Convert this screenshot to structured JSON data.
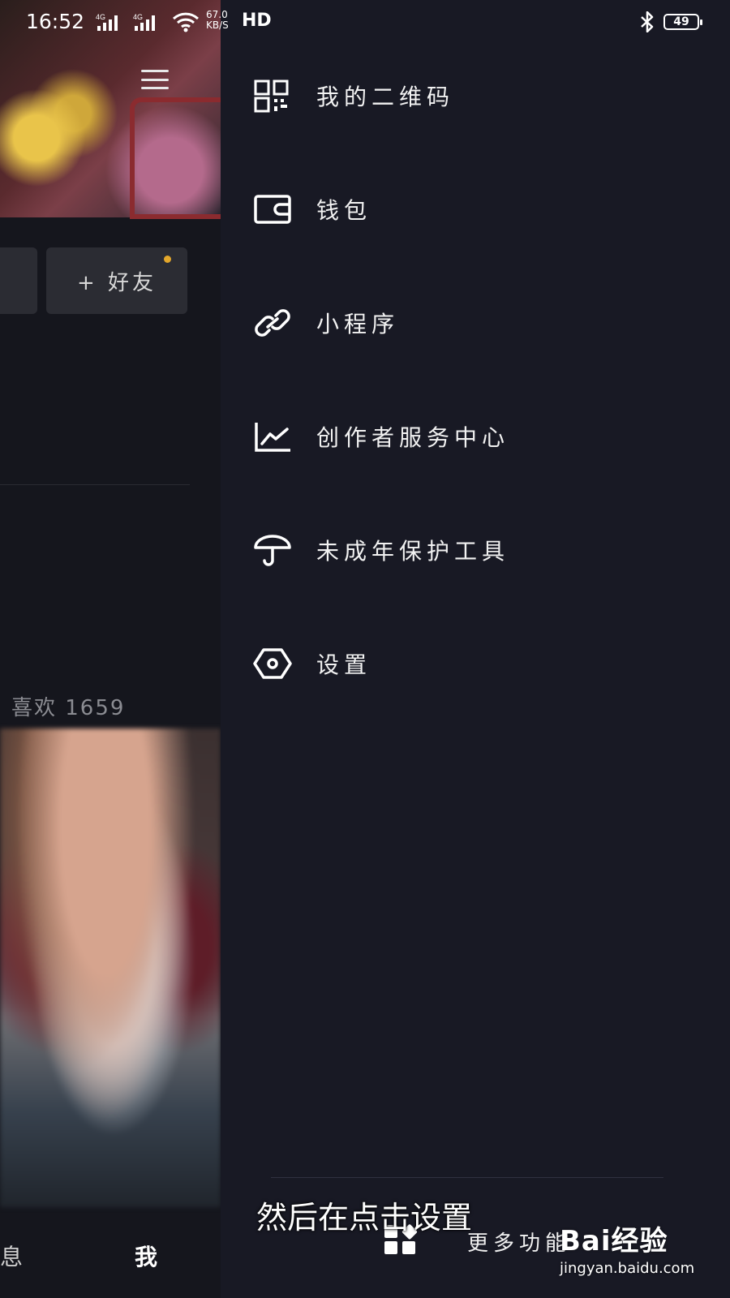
{
  "status_bar": {
    "time": "16:52",
    "network_type": "4G",
    "speed_value": "67.0",
    "speed_unit": "KB/S",
    "hd": "HD",
    "battery": "49"
  },
  "background_page": {
    "add_friend": "+ 好友",
    "likes": "喜欢 1659",
    "tab_message": "息",
    "tab_me": "我"
  },
  "drawer": {
    "items": [
      {
        "label": "我的二维码",
        "icon": "qr-code-icon"
      },
      {
        "label": "钱包",
        "icon": "wallet-icon"
      },
      {
        "label": "小程序",
        "icon": "link-icon"
      },
      {
        "label": "创作者服务中心",
        "icon": "chart-icon"
      },
      {
        "label": "未成年保护工具",
        "icon": "umbrella-icon"
      },
      {
        "label": "设置",
        "icon": "hexagon-settings-icon"
      }
    ],
    "more_functions": "更多功能"
  },
  "overlay": {
    "subtitle": "然后在点击设置",
    "watermark_brand": "Bai经验",
    "watermark_url": "jingyan.baidu.com"
  },
  "colors": {
    "drawer_bg": "#181924",
    "page_bg": "#15161d",
    "notification_dot": "#e3a72b"
  }
}
